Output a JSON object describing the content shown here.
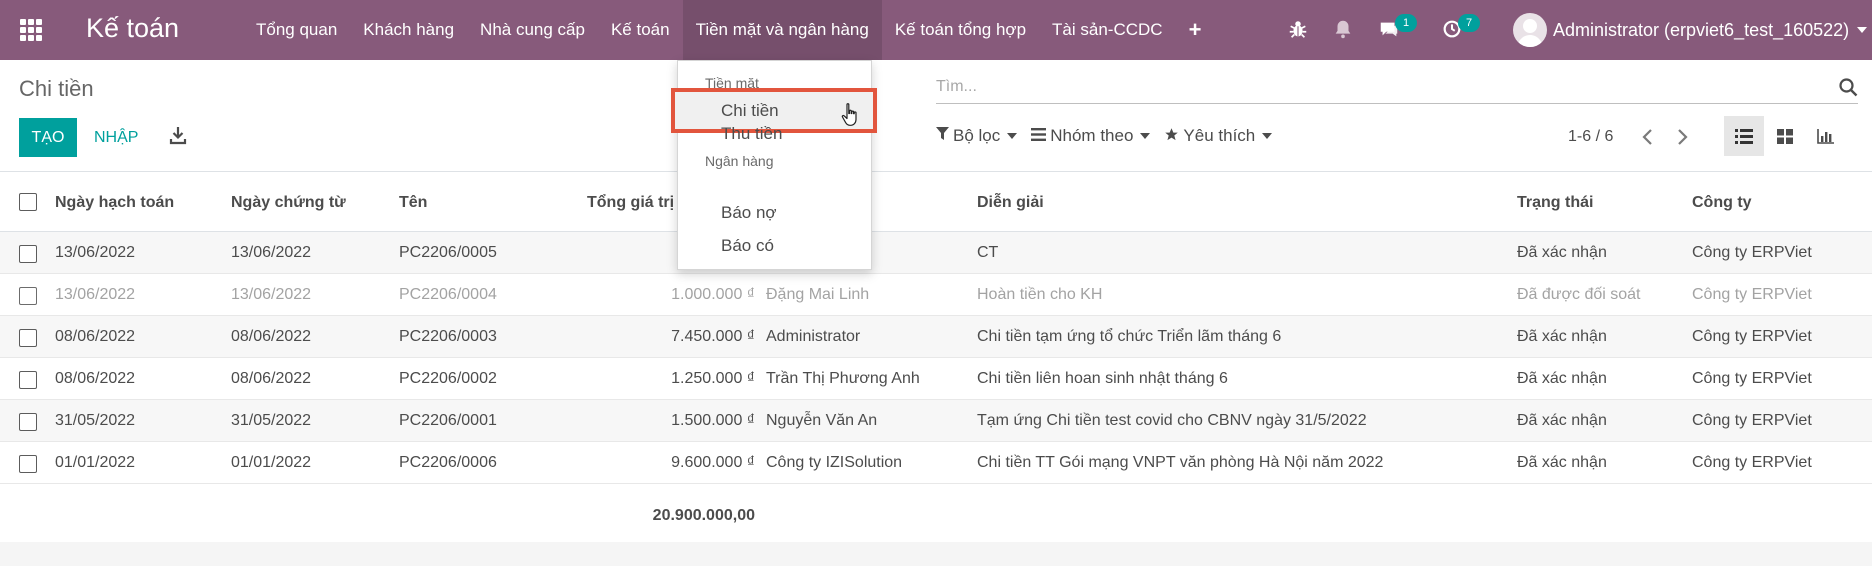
{
  "app": {
    "brand": "Kế toán",
    "menu": [
      {
        "label": "Tổng quan"
      },
      {
        "label": "Khách hàng"
      },
      {
        "label": "Nhà cung cấp"
      },
      {
        "label": "Kế toán"
      },
      {
        "label": "Tiền mặt và ngân hàng",
        "active": true
      },
      {
        "label": "Kế toán tổng hợp"
      },
      {
        "label": "Tài sản-CCDC"
      }
    ],
    "plus_label": "+",
    "messages_badge": "1",
    "activities_badge": "7",
    "user_name": "Administrator (erpviet6_test_160522)"
  },
  "control": {
    "breadcrumb": "Chi tiền",
    "create_label": "TẠO",
    "import_label": "NHẬP",
    "search_placeholder": "Tìm...",
    "filters_label": "Bộ lọc",
    "groupby_label": "Nhóm theo",
    "favorites_label": "Yêu thích",
    "pager": "1-6 / 6"
  },
  "dropdown": {
    "cash_header": "Tiền mặt",
    "items_cash": [
      "Chi tiền",
      "Thu tiền"
    ],
    "bank_header": "Ngân hàng",
    "items_bank": [
      "Báo nợ",
      "Báo có"
    ]
  },
  "table": {
    "columns": [
      "Ngày hạch toán",
      "Ngày chứng từ",
      "Tên",
      "Tổng giá trị",
      "Diễn giải",
      "Trạng thái",
      "Công ty"
    ],
    "rows": [
      {
        "accounting_date": "13/06/2022",
        "doc_date": "13/06/2022",
        "name": "PC2206/0005",
        "amount": "",
        "partner": "",
        "description": "CT",
        "state": "Đã xác nhận",
        "company": "Công ty ERPViet"
      },
      {
        "accounting_date": "13/06/2022",
        "doc_date": "13/06/2022",
        "name": "PC2206/0004",
        "amount": "1.000.000 ₫",
        "partner": "Đặng Mai Linh",
        "description": "Hoàn tiền cho KH",
        "state": "Đã được đối soát",
        "company": "Công ty ERPViet",
        "muted": true
      },
      {
        "accounting_date": "08/06/2022",
        "doc_date": "08/06/2022",
        "name": "PC2206/0003",
        "amount": "7.450.000 ₫",
        "partner": "Administrator",
        "description": "Chi tiền tạm ứng tổ chức Triển lãm tháng 6",
        "state": "Đã xác nhận",
        "company": "Công ty ERPViet"
      },
      {
        "accounting_date": "08/06/2022",
        "doc_date": "08/06/2022",
        "name": "PC2206/0002",
        "amount": "1.250.000 ₫",
        "partner": "Trần Thị Phương Anh",
        "description": "Chi tiền liên hoan sinh nhật tháng 6",
        "state": "Đã xác nhận",
        "company": "Công ty ERPViet"
      },
      {
        "accounting_date": "31/05/2022",
        "doc_date": "31/05/2022",
        "name": "PC2206/0001",
        "amount": "1.500.000 ₫",
        "partner": "Nguyễn Văn An",
        "description": "Tạm ứng Chi tiền test covid cho CBNV ngày 31/5/2022",
        "state": "Đã xác nhận",
        "company": "Công ty ERPViet"
      },
      {
        "accounting_date": "01/01/2022",
        "doc_date": "01/01/2022",
        "name": "PC2206/0006",
        "amount": "9.600.000 ₫",
        "partner": "Công ty IZISolution",
        "description": "Chi tiền TT Gói mạng VNPT văn phòng Hà Nội năm 2022",
        "state": "Đã xác nhận",
        "company": "Công ty ERPViet"
      }
    ],
    "total": "20.900.000,00"
  }
}
